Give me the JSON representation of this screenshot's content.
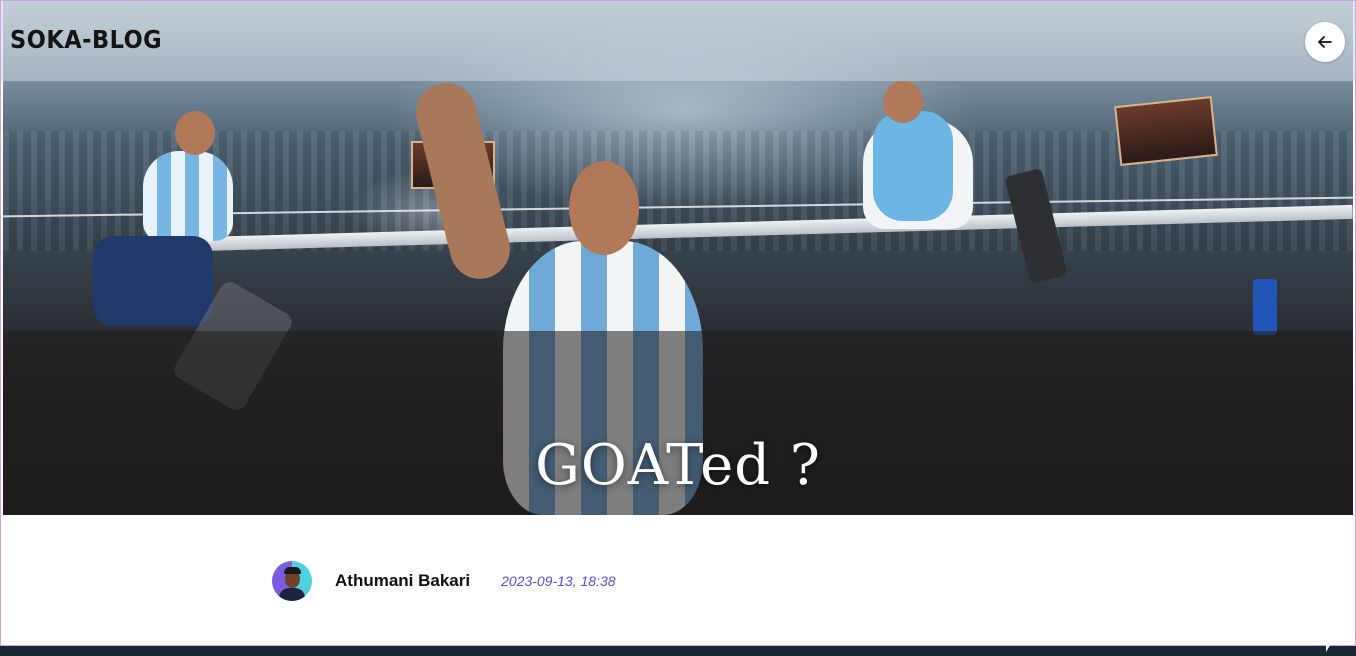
{
  "header": {
    "brand": "SOKA-BLOG",
    "back_icon": "arrow-left-icon"
  },
  "hero": {
    "title": "GOATed ?"
  },
  "post_meta": {
    "author": "Athumani Bakari",
    "date": "2023-09-13, 18:38",
    "avatar_icon": "avatar-icon"
  },
  "colors": {
    "date_text": "#5a4fcf",
    "frame_border": "#c9a3e6"
  }
}
